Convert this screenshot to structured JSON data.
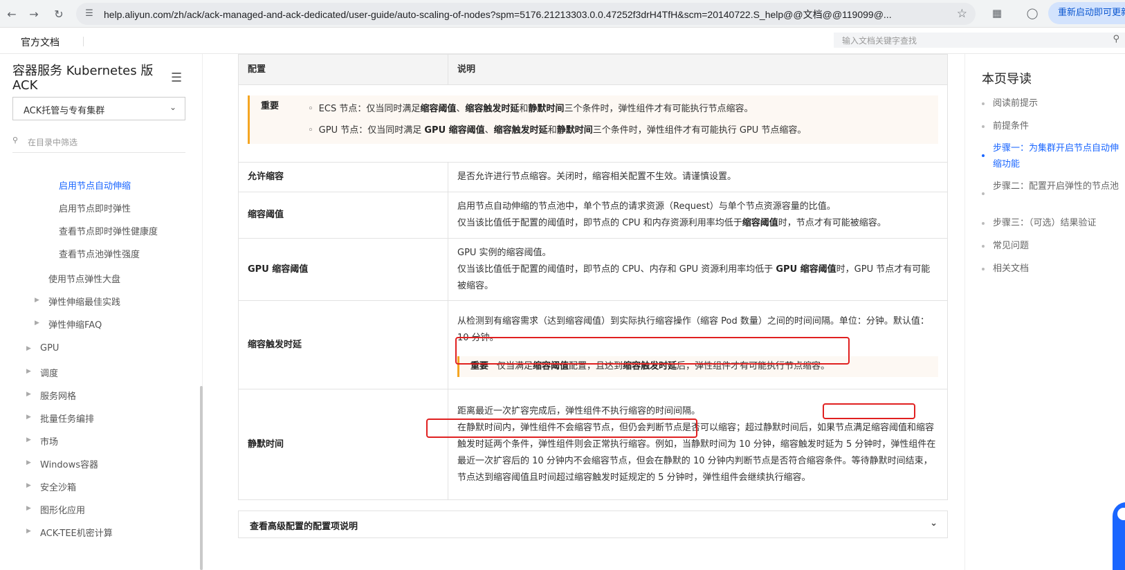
{
  "browser": {
    "url": "help.aliyun.com/zh/ack/ack-managed-and-ack-dedicated/user-guide/auto-scaling-of-nodes?spm=5176.21213303.0.0.47252f3drH4TfH&scm=20140722.S_help@@文档@@119099@...",
    "restart_label": "重新启动即可更新"
  },
  "topnav": {
    "docs_title": "官方文档",
    "search_placeholder": "输入文档关键字查找"
  },
  "sidebar": {
    "product_title": "容器服务 Kubernetes 版 ACK",
    "cluster_select": "ACK托管与专有集群",
    "filter_placeholder": "在目录中筛选",
    "items": [
      {
        "label": "启用节点自动伸缩"
      },
      {
        "label": "启用节点即时弹性"
      },
      {
        "label": "查看节点即时弹性健康度"
      },
      {
        "label": "查看节点池弹性强度"
      },
      {
        "label": "使用节点弹性大盘"
      },
      {
        "label": "弹性伸缩最佳实践"
      },
      {
        "label": "弹性伸缩FAQ"
      },
      {
        "label": "GPU"
      },
      {
        "label": "调度"
      },
      {
        "label": "服务网格"
      },
      {
        "label": "批量任务编排"
      },
      {
        "label": "市场"
      },
      {
        "label": "Windows容器"
      },
      {
        "label": "安全沙箱"
      },
      {
        "label": "图形化应用"
      },
      {
        "label": "ACK-TEE机密计算"
      }
    ]
  },
  "table": {
    "headers": [
      "配置",
      "说明"
    ],
    "important_label": "重要",
    "note_top": {
      "ecs": [
        "ECS 节点：仅当同时满足",
        "缩容阈值",
        "、",
        "缩容触发时延",
        "和",
        "静默时间",
        "三个条件时，弹性组件才有可能执行节点缩容。"
      ],
      "gpu": [
        "GPU 节点：仅当同时满足 ",
        "GPU 缩容阈值",
        "、",
        "缩容触发时延",
        "和",
        "静默时间",
        "三个条件时，弹性组件才有可能执行 GPU 节点缩容。"
      ]
    },
    "rows": {
      "allow": {
        "name": "允许缩容",
        "desc": "是否允许进行节点缩容。关闭时，缩容相关配置不生效。请谨慎设置。"
      },
      "threshold": {
        "name": "缩容阈值",
        "line1": "启用节点自动伸缩的节点池中，单个节点的请求资源（Request）与单个节点资源容量的比值。",
        "line2a": "仅当该比值低于配置的阈值时，即节点的 CPU 和内存资源利用率均低于",
        "line2b": "缩容阈值",
        "line2c": "时，节点才有可能被缩容。"
      },
      "gpu_threshold": {
        "name": "GPU 缩容阈值",
        "line1": "GPU 实例的缩容阈值。",
        "line2a": "仅当该比值低于配置的阈值时，即节点的 CPU、内存和 GPU 资源利用率均低于 ",
        "line2b": "GPU 缩容阈值",
        "line2c": "时，GPU 节点才有可能被缩容。"
      },
      "delay": {
        "name": "缩容触发时延",
        "desc": "从检测到有缩容需求（达到缩容阈值）到实际执行缩容操作（缩容 Pod 数量）之间的时间间隔。单位：分钟。默认值：10 分钟。",
        "note_a": "仅当满足",
        "note_b": "缩容阈值",
        "note_c": "配置，且达到",
        "note_d": "缩容触发时延",
        "note_e": "后，弹性组件才有可能执行节点缩容。"
      },
      "cooldown": {
        "name": "静默时间",
        "line1": "距离最近一次扩容完成后，弹性组件不执行缩容的时间间隔。",
        "line2": "在静默时间内，弹性组件不会缩容节点，但仍会判断节点是否可以缩容；超过静默时间后，如果节点满足缩容阈值和缩容触发时延两个条件，弹性组件则会正常执行缩容。例如，当静默时间为 10 分钟，缩容触发时延为 5 分钟时，弹性组件在最近一次扩容后的 10 分钟内不会缩容节点，但会在静默的 10 分钟内判断节点是否符合缩容条件。等待静默时间结束，节点达到缩容阈值且时间超过缩容触发时延规定的 5 分钟时，弹性组件会继续执行缩容。"
      }
    },
    "advanced_label": "查看高级配置的配置项说明"
  },
  "toc": {
    "title": "本页导读",
    "items": [
      {
        "label": "阅读前提示"
      },
      {
        "label": "前提条件"
      },
      {
        "label": "步骤一：为集群开启节点自动伸缩功能"
      },
      {
        "label": "步骤二：配置开启弹性的节点池"
      },
      {
        "label": "步骤三：（可选）结果验证"
      },
      {
        "label": "常见问题"
      },
      {
        "label": "相关文档"
      }
    ]
  },
  "colors": {
    "accent": "#1a66ff",
    "highlight_box": "#e02020",
    "note_border": "#f5a623"
  }
}
